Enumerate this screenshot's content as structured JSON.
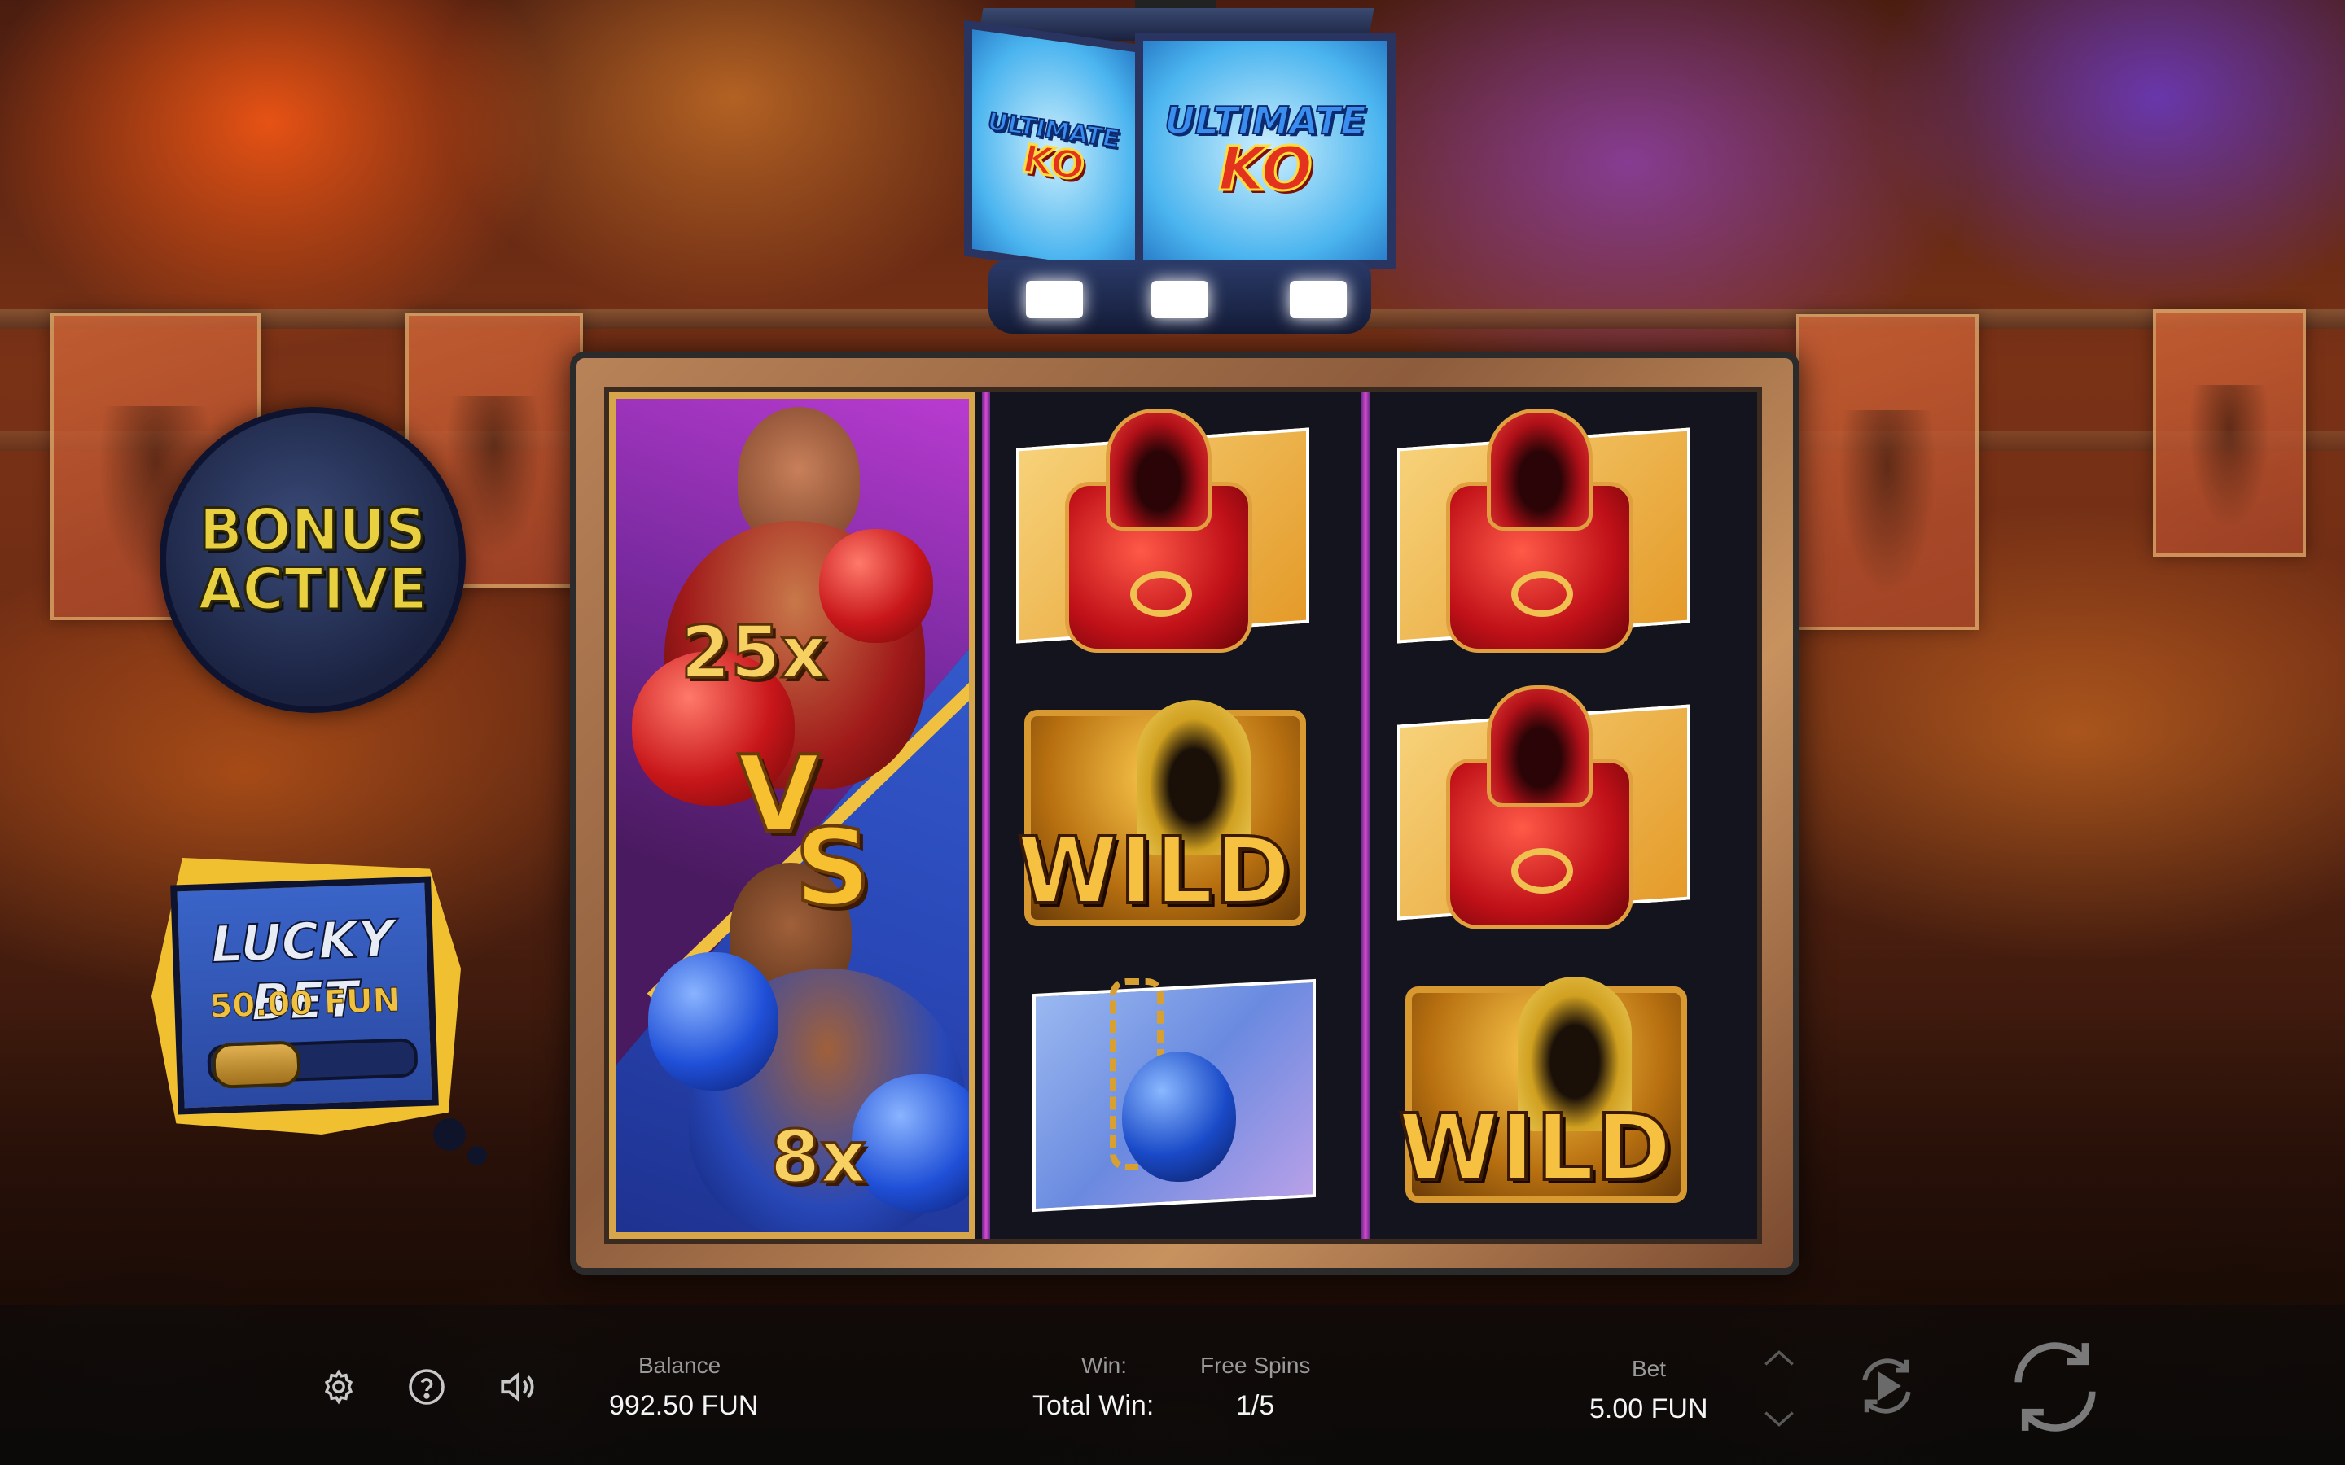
{
  "game": {
    "logo_line1": "ULTIMATE",
    "logo_line2": "KO"
  },
  "feature_column": {
    "top_multiplier": "25x",
    "vs_v": "V",
    "vs_s": "S",
    "bottom_multiplier": "8x"
  },
  "reels": [
    [
      {
        "symbol": "robe"
      },
      {
        "symbol": "wild",
        "label": "WILD"
      },
      {
        "symbol": "punching-bag"
      }
    ],
    [
      {
        "symbol": "robe"
      },
      {
        "symbol": "robe"
      },
      {
        "symbol": "wild",
        "label": "WILD"
      }
    ]
  ],
  "bonus_badge": {
    "line1": "BONUS",
    "line2": "ACTIVE"
  },
  "lucky_bet": {
    "title": "LUCKY BET",
    "amount": "50.00 FUN",
    "enabled": false
  },
  "bottom_bar": {
    "balance_label": "Balance",
    "balance_value": "992.50 FUN",
    "win_label": "Win:",
    "total_win_label": "Total Win:",
    "free_spins_label": "Free Spins",
    "free_spins_value": "1/5",
    "bet_label": "Bet",
    "bet_value": "5.00 FUN"
  },
  "icons": {
    "settings": "gear-icon",
    "help": "question-icon",
    "sound": "speaker-icon",
    "bet_up": "chevron-up-icon",
    "bet_down": "chevron-down-icon",
    "autoplay": "autoplay-icon",
    "spin": "spin-icon"
  }
}
